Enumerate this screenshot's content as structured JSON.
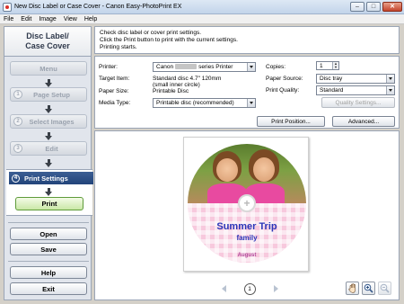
{
  "window": {
    "title": "New Disc Label or Case Cover - Canon Easy-PhotoPrint EX",
    "minimize": "–",
    "maximize": "□",
    "close": "✕"
  },
  "menu": [
    "File",
    "Edit",
    "Image",
    "View",
    "Help"
  ],
  "sidebar": {
    "header_line1": "Disc Label/",
    "header_line2": "Case Cover",
    "menu_label": "Menu",
    "steps": [
      {
        "num": "1",
        "label": "Page Setup"
      },
      {
        "num": "2",
        "label": "Select Images"
      },
      {
        "num": "3",
        "label": "Edit"
      },
      {
        "num": "4",
        "label": "Print Settings"
      }
    ],
    "print_label": "Print",
    "open_label": "Open",
    "save_label": "Save",
    "help_label": "Help",
    "exit_label": "Exit"
  },
  "info": {
    "line1": "Check disc label or cover print settings.",
    "line2": "Click the Print button to print with the current settings.",
    "line3": "Printing starts."
  },
  "settings": {
    "printer_label": "Printer:",
    "printer_prefix": "Canon",
    "printer_suffix": "series Printer",
    "target_label": "Target Item:",
    "target_value1": "Standard disc 4.7\" 120mm",
    "target_value2": "(small inner circle)",
    "paper_size_label": "Paper Size:",
    "paper_size_value": "Printable Disc",
    "media_label": "Media Type:",
    "media_value": "Printable disc (recommended)",
    "copies_label": "Copies:",
    "copies_value": "1",
    "source_label": "Paper Source:",
    "source_value": "Disc tray",
    "quality_label": "Print Quality:",
    "quality_value": "Standard",
    "quality_settings_button": "Quality Settings...",
    "print_position_button": "Print Position...",
    "advanced_button": "Advanced..."
  },
  "preview": {
    "disc_title": "Summer Trip",
    "disc_subtitle": "family",
    "disc_month": "August",
    "page_number": "1"
  },
  "colors": {
    "accent_tab": "#22447a",
    "disc_text": "#2b35b8",
    "gingham": "#f7c9dd",
    "print_button": "#c9e7a6"
  }
}
